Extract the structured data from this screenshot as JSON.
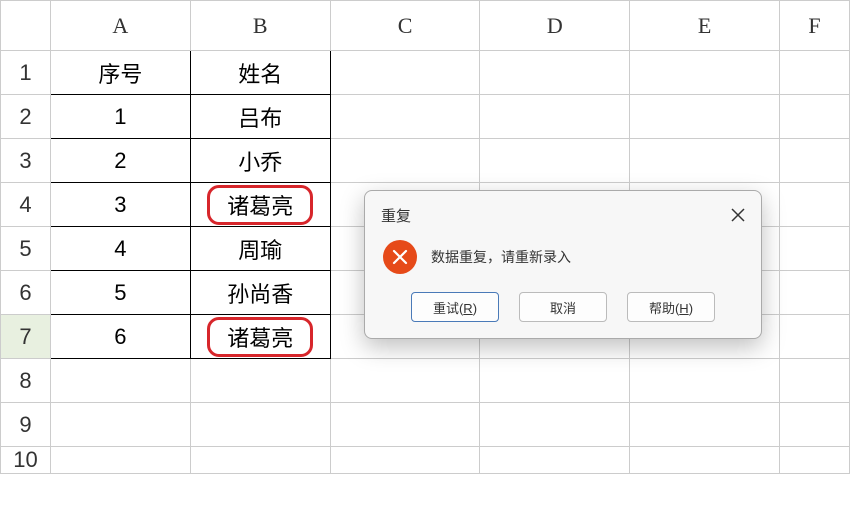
{
  "columns": [
    "A",
    "B",
    "C",
    "D",
    "E",
    "F"
  ],
  "row_numbers": [
    "1",
    "2",
    "3",
    "4",
    "5",
    "6",
    "7",
    "8",
    "9",
    "10"
  ],
  "active_row": "7",
  "header_row": {
    "a": "序号",
    "b": "姓名"
  },
  "rows": [
    {
      "a": "1",
      "b": "吕布",
      "hl": false
    },
    {
      "a": "2",
      "b": "小乔",
      "hl": false
    },
    {
      "a": "3",
      "b": "诸葛亮",
      "hl": true
    },
    {
      "a": "4",
      "b": "周瑜",
      "hl": false
    },
    {
      "a": "5",
      "b": "孙尚香",
      "hl": false
    },
    {
      "a": "6",
      "b": "诸葛亮",
      "hl": true
    }
  ],
  "dialog": {
    "title": "重复",
    "message": "数据重复，请重新录入",
    "retry_prefix": "重试(",
    "retry_key": "R",
    "retry_suffix": ")",
    "cancel": "取消",
    "help_prefix": "帮助(",
    "help_key": "H",
    "help_suffix": ")"
  }
}
